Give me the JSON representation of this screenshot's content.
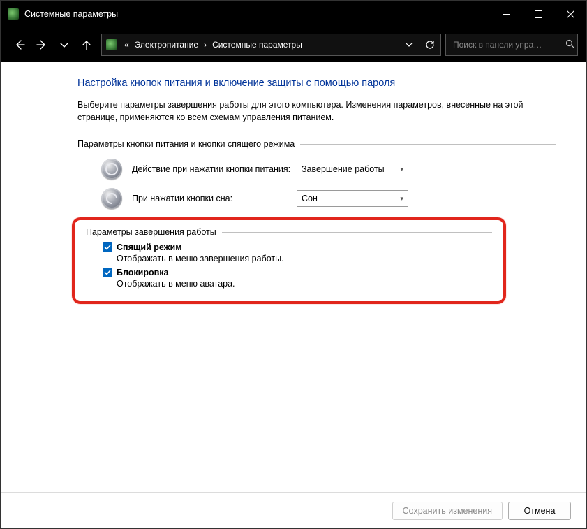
{
  "titlebar": {
    "title": "Системные параметры"
  },
  "breadcrumbs": {
    "item1": "Электропитание",
    "item2": "Системные параметры"
  },
  "search": {
    "placeholder": "Поиск в панели упра…"
  },
  "page": {
    "heading": "Настройка кнопок питания и включение защиты с помощью пароля",
    "desc": "Выберите параметры завершения работы для этого компьютера. Изменения параметров, внесенные на этой странице, применяются ко всем схемам управления питанием."
  },
  "section_buttons": {
    "label": "Параметры кнопки питания и кнопки спящего режима",
    "power_label": "Действие при нажатии кнопки питания:",
    "power_value": "Завершение работы",
    "sleep_label": "При нажатии кнопки сна:",
    "sleep_value": "Сон"
  },
  "section_shutdown": {
    "label": "Параметры завершения работы",
    "opt1_title": "Спящий режим",
    "opt1_sub": "Отображать в меню завершения работы.",
    "opt1_checked": true,
    "opt2_title": "Блокировка",
    "opt2_sub": "Отображать в меню аватара.",
    "opt2_checked": true
  },
  "footer": {
    "save": "Сохранить изменения",
    "cancel": "Отмена"
  }
}
